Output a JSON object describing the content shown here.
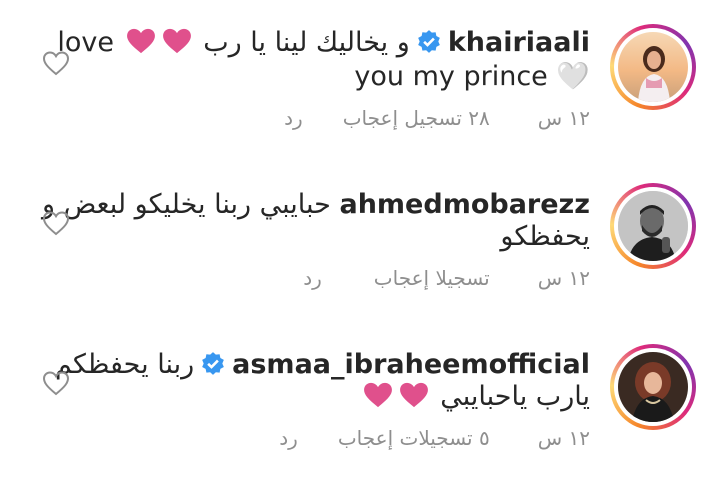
{
  "comments": [
    {
      "username": "khairiaali",
      "verified": true,
      "line1_text": "و يخاليك لينا يا رب",
      "line1_tail": "love",
      "line2_text": "you my prince 🤍",
      "time": "١٢ س",
      "likes": "٢٨ تسجيل إعجاب",
      "reply": "رد"
    },
    {
      "username": "ahmedmobarezz",
      "verified": false,
      "line1_text": "حبايبي ربنا يخليكو لبعض و",
      "line2_text": "يحفظكو",
      "time": "١٢ س",
      "likes": "تسجيلا إعجاب",
      "reply": "رد"
    },
    {
      "username": "asmaa_ibraheemofficial",
      "verified": true,
      "line1_text": "ربنا يحفظكم",
      "line2_text": "يارب ياحبايبي",
      "time": "١٢ س",
      "likes": "٥ تسجيلات إعجاب",
      "reply": "رد"
    }
  ],
  "colors": {
    "heart_pink": "#e0508c",
    "verified_blue": "#3897f0",
    "meta_gray": "#8e8e8e"
  }
}
